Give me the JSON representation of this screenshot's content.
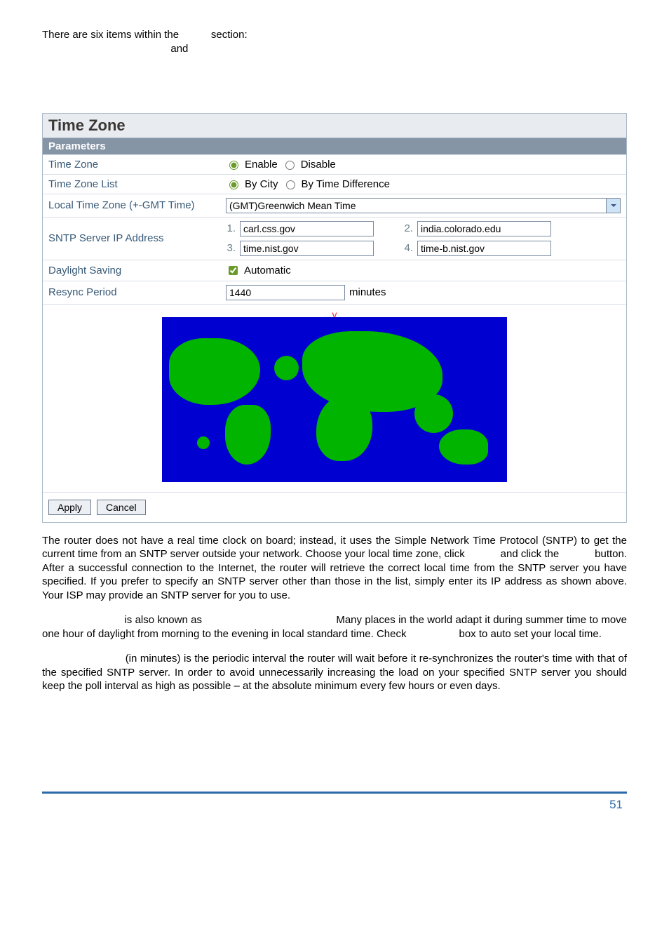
{
  "intro": {
    "line1_a": "There are six items within the ",
    "line1_b": " section: ",
    "line2": " and "
  },
  "panel": {
    "title": "Time Zone",
    "subtitle": "Parameters",
    "rows": {
      "tz_label": "Time Zone",
      "tz_opts": [
        "Enable",
        "Disable"
      ],
      "tzlist_label": "Time Zone List",
      "tzlist_opts": [
        "By City",
        "By Time Difference"
      ],
      "local_label": "Local Time Zone (+-GMT Time)",
      "local_value": "(GMT)Greenwich Mean Time",
      "sntp_label": "SNTP Server IP Address",
      "sntp": {
        "n1": "1.",
        "v1": "carl.css.gov",
        "n2": "2.",
        "v2": "india.colorado.edu",
        "n3": "3.",
        "v3": "time.nist.gov",
        "n4": "4.",
        "v4": "time-b.nist.gov"
      },
      "ds_label": "Daylight Saving",
      "ds_value": "Automatic",
      "resync_label": "Resync Period",
      "resync_value": "1440",
      "resync_unit": "minutes"
    },
    "marker": "v",
    "buttons": {
      "apply": "Apply",
      "cancel": "Cancel"
    }
  },
  "body": {
    "p1_a": "The router does not have a real time clock on board; instead, it uses the Simple Network Time Protocol (SNTP) to get the current time from an SNTP server outside your network. Choose your local time zone, click ",
    "p1_b": " and click the ",
    "p1_c": " button. After a successful connection to the Internet, the router will retrieve the correct local time from the SNTP server you have specified. If you prefer to specify an SNTP server other than those in the list, simply enter its IP address as shown above. Your ISP may provide an SNTP server for you to use.",
    "p2_a": " is also known as ",
    "p2_b": " Many places in the world adapt it during summer time to move one hour of daylight from morning to the evening in local standard time. Check ",
    "p2_c": " box to auto set your local time.",
    "p3": " (in minutes) is the periodic interval the router will wait before it re-synchronizes the router's time with that of the specified SNTP server. In order to avoid unnecessarily increasing the load on your specified SNTP server you should keep the poll interval as high as possible – at the absolute minimum every few hours or even days."
  },
  "footer": {
    "page": "51"
  }
}
